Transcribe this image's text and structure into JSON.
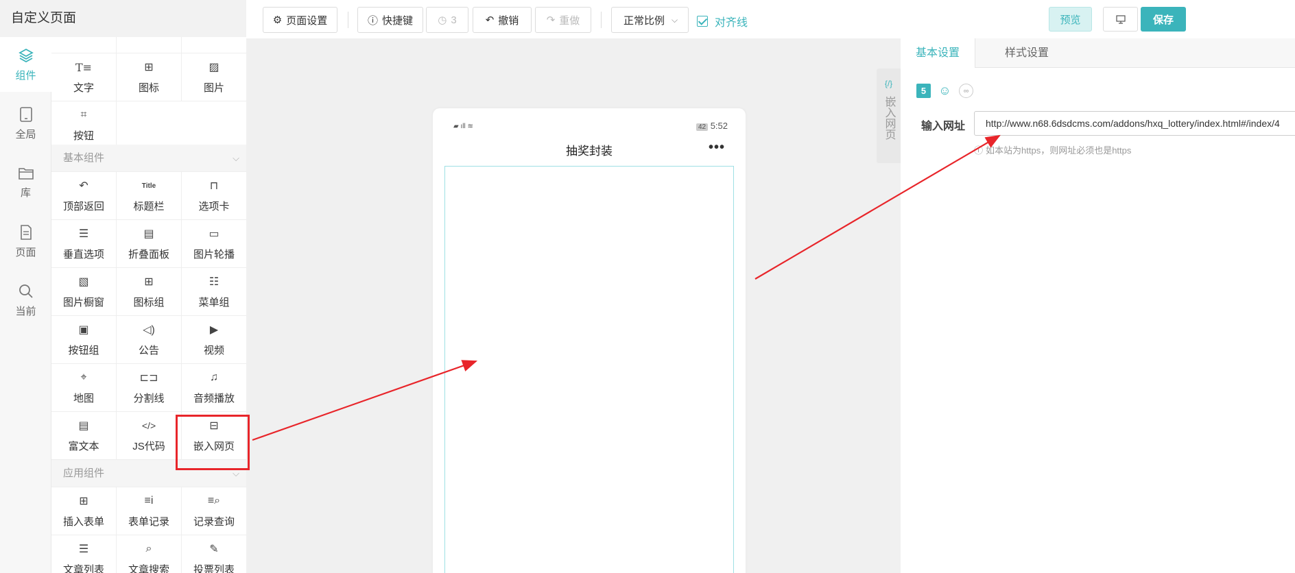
{
  "app": {
    "title": "自定义页面"
  },
  "toolbar": {
    "page_settings": "页面设置",
    "shortcuts": "快捷键",
    "history_count": "3",
    "undo": "撤销",
    "redo": "重做",
    "ratio": "正常比例",
    "align_lines": "对齐线",
    "preview": "预览",
    "save": "保存"
  },
  "rail": {
    "items": [
      {
        "label": "组件",
        "icon": "layers-icon",
        "active": true
      },
      {
        "label": "全局",
        "icon": "tablet-icon"
      },
      {
        "label": "库",
        "icon": "folder-icon"
      },
      {
        "label": "页面",
        "icon": "page-icon"
      },
      {
        "label": "当前",
        "icon": "search-icon"
      }
    ]
  },
  "components": {
    "top_row": [
      {
        "label": "文字",
        "icon": "text-icon"
      },
      {
        "label": "图标",
        "icon": "grid-icon"
      },
      {
        "label": "图片",
        "icon": "image-icon"
      },
      {
        "label": "按钮",
        "icon": "button-icon"
      }
    ],
    "basic_header": "基本组件",
    "basic": [
      {
        "label": "顶部返回",
        "icon": "back-icon"
      },
      {
        "label": "标题栏",
        "icon": "title-icon"
      },
      {
        "label": "选项卡",
        "icon": "tabs-icon"
      },
      {
        "label": "垂直选项",
        "icon": "vertical-list-icon"
      },
      {
        "label": "折叠面板",
        "icon": "collapse-icon"
      },
      {
        "label": "图片轮播",
        "icon": "carousel-icon"
      },
      {
        "label": "图片橱窗",
        "icon": "gallery-icon"
      },
      {
        "label": "图标组",
        "icon": "icon-group-icon"
      },
      {
        "label": "菜单组",
        "icon": "menu-icon"
      },
      {
        "label": "按钮组",
        "icon": "button-group-icon"
      },
      {
        "label": "公告",
        "icon": "speaker-icon"
      },
      {
        "label": "视频",
        "icon": "video-icon"
      },
      {
        "label": "地图",
        "icon": "map-icon"
      },
      {
        "label": "分割线",
        "icon": "divider-icon"
      },
      {
        "label": "音频播放",
        "icon": "music-icon"
      },
      {
        "label": "富文本",
        "icon": "richtext-icon"
      },
      {
        "label": "JS代码",
        "icon": "code-icon"
      },
      {
        "label": "嵌入网页",
        "icon": "embed-icon"
      }
    ],
    "app_header": "应用组件",
    "app": [
      {
        "label": "插入表单",
        "icon": "form-add-icon"
      },
      {
        "label": "表单记录",
        "icon": "form-record-icon"
      },
      {
        "label": "记录查询",
        "icon": "record-search-icon"
      },
      {
        "label": "文章列表",
        "icon": "article-list-icon"
      },
      {
        "label": "文章搜索",
        "icon": "article-search-icon"
      },
      {
        "label": "投票列表",
        "icon": "vote-icon"
      }
    ]
  },
  "phone": {
    "time": "5:52",
    "battery": "42",
    "title": "抽奖封装",
    "more": "•••"
  },
  "side_tab": {
    "code": "{/}",
    "label": "嵌入网页"
  },
  "settings": {
    "tabs": [
      "基本设置",
      "样式设置"
    ],
    "url_label": "输入网址",
    "url_value": "http://www.n68.6dsdcms.com/addons/hxq_lottery/index.html#/index/4",
    "hint": "如本站为https，则网址必须也是https"
  },
  "colors": {
    "accent": "#3bb4bb",
    "annotation": "#e8252a"
  }
}
